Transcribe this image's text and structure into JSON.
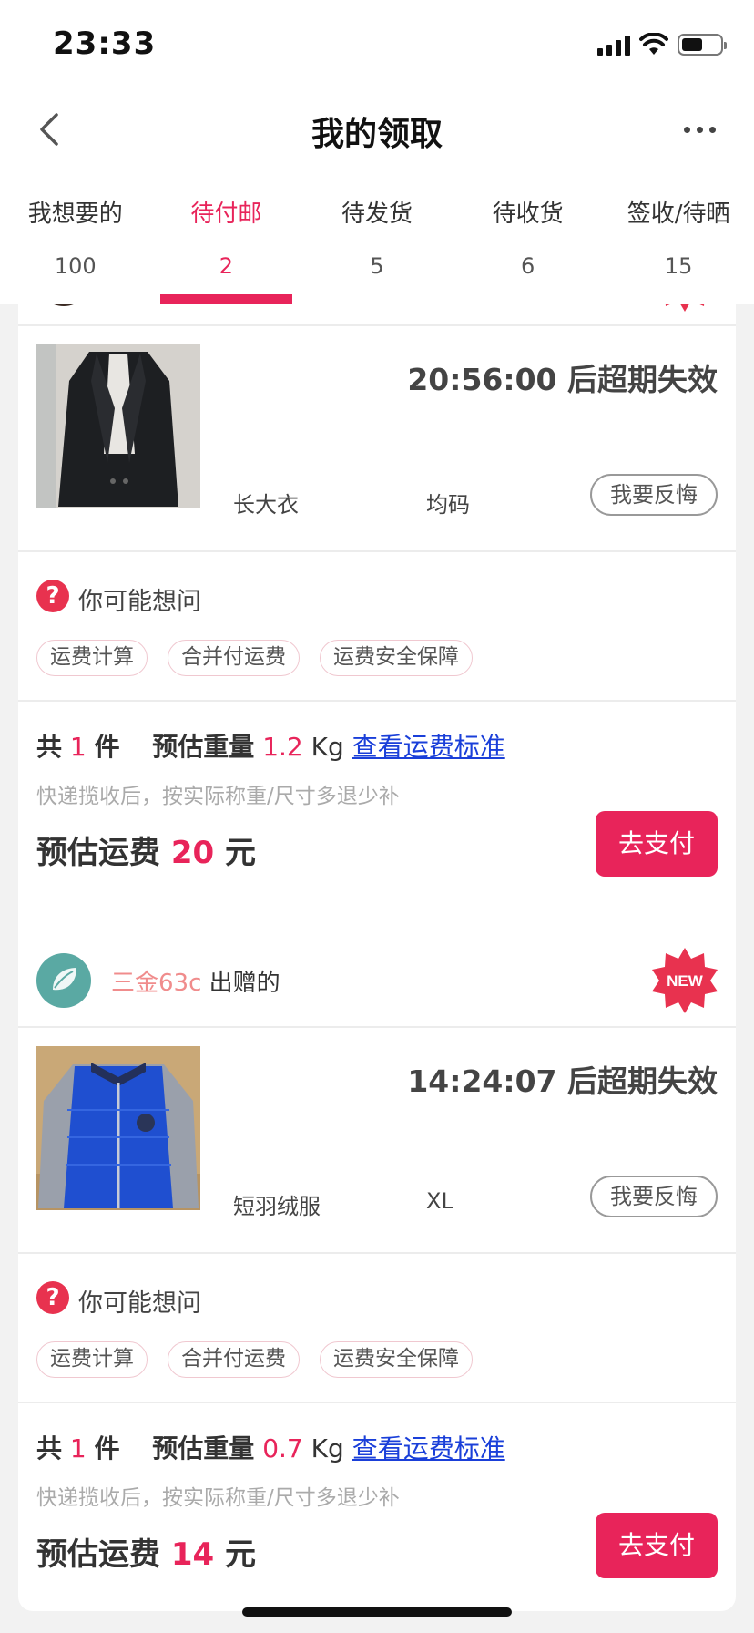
{
  "status_bar": {
    "time": "23:33"
  },
  "nav": {
    "title": "我的领取"
  },
  "tabs": [
    {
      "label": "我想要的",
      "count": "100"
    },
    {
      "label": "待付邮",
      "count": "2"
    },
    {
      "label": "待发货",
      "count": "5"
    },
    {
      "label": "待收货",
      "count": "6"
    },
    {
      "label": "签收/待晒",
      "count": "15"
    }
  ],
  "active_tab": "待付邮",
  "common": {
    "faq_title": "你可能想问",
    "chips": [
      "运费计算",
      "合并付运费",
      "运费安全保障"
    ],
    "regret_label": "我要反悔",
    "note": "快递揽收后，按实际称重/尺寸多退少补",
    "pay_label": "去支付",
    "count_prefix": "共",
    "count_unit": "件",
    "weight_label": "预估重量",
    "weight_unit": "Kg",
    "standard_link": "查看运费标准",
    "fee_label": "预估运费",
    "fee_unit": "元",
    "expire_suffix": "后超期失效",
    "new_badge": "NEW"
  },
  "orders": [
    {
      "product_name": "长大衣",
      "size": "均码",
      "countdown": "20:56:00",
      "count": "1",
      "weight": "1.2",
      "fee": "20"
    },
    {
      "giver_name": "三金63c",
      "giver_suffix": "出赠的",
      "product_name": "短羽绒服",
      "size": "XL",
      "countdown": "14:24:07",
      "count": "1",
      "weight": "0.7",
      "fee": "14"
    }
  ],
  "colors": {
    "accent": "#e8245a",
    "link": "#1a3fd9",
    "giver": "#f08c8c"
  }
}
